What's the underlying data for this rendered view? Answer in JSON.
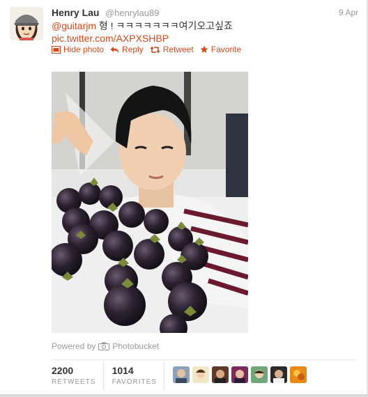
{
  "tweet": {
    "author_name": "Henry Lau",
    "author_handle": "@henrylau89",
    "timestamp": "9 Apr",
    "mention": "@guitarjm",
    "text_body": " 형 ! ㅋㅋㅋㅋㅋㅋㅋ여기오고싶죠",
    "link": "pic.twitter.com/AXPXSHBP"
  },
  "actions": {
    "hide_photo": "Hide photo",
    "reply": "Reply",
    "retweet": "Retweet",
    "favorite": "Favorite"
  },
  "media": {
    "powered_by": "Powered by",
    "provider": "Photobucket"
  },
  "stats": {
    "retweets_count": "2200",
    "retweets_label": "RETWEETS",
    "favorites_count": "1014",
    "favorites_label": "FAVORITES"
  },
  "colors": {
    "link": "#d2491c",
    "muted": "#999999"
  }
}
